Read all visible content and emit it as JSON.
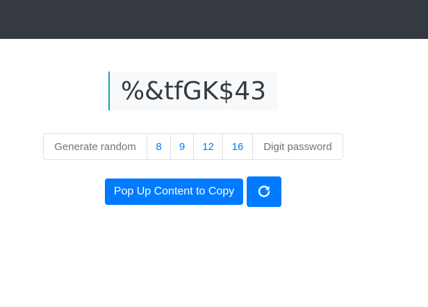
{
  "password": {
    "value": "%&tfGK$43"
  },
  "length_selector": {
    "prefix": "Generate random",
    "options": [
      "8",
      "9",
      "12",
      "16"
    ],
    "suffix": "Digit password"
  },
  "actions": {
    "copy_label": "Pop Up Content to Copy",
    "refresh_icon": "refresh-icon"
  },
  "colors": {
    "navbar": "#343a40",
    "primary": "#007bff",
    "display_bg": "#f8f9fa",
    "display_accent": "#17a2b8",
    "muted_text": "#6c757d"
  }
}
